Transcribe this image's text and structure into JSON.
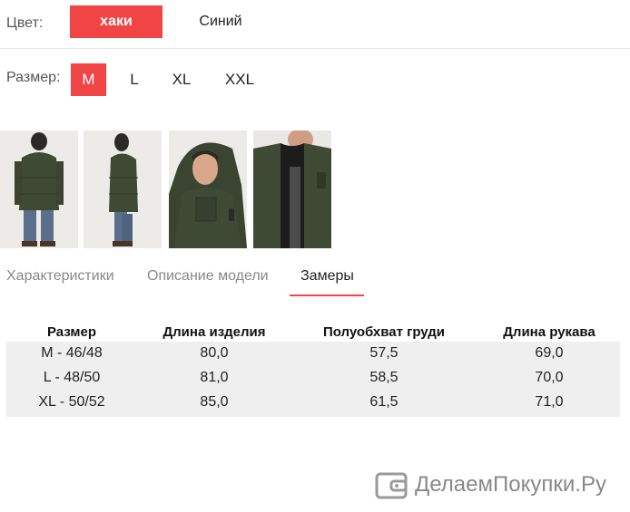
{
  "color": {
    "label": "Цвет:",
    "options": [
      "хаки",
      "Синий"
    ],
    "selected": 0
  },
  "size": {
    "label": "Размер:",
    "options": [
      "M",
      "L",
      "XL",
      "XXL"
    ],
    "selected": 0
  },
  "gallery": {
    "images": [
      "jacket-front-photo",
      "jacket-side-photo",
      "jacket-hood-closeup-photo",
      "jacket-lining-photo"
    ]
  },
  "tabs": {
    "items": [
      "Характеристики",
      "Описание модели",
      "Замеры"
    ],
    "active": 2
  },
  "table": {
    "headers": [
      "Размер",
      "Длина изделия",
      "Полуобхват груди",
      "Длина рукава"
    ],
    "rows": [
      [
        "M - 46/48",
        "80,0",
        "57,5",
        "69,0"
      ],
      [
        "L - 48/50",
        "81,0",
        "58,5",
        "70,0"
      ],
      [
        "XL - 50/52",
        "85,0",
        "61,5",
        "71,0"
      ]
    ]
  },
  "watermark": {
    "text": "ДелаемПокупки.Ру",
    "icon": "wallet-icon"
  },
  "colors": {
    "accent": "#f04445",
    "khaki": "#3f4a35",
    "row_bg": "#efefef"
  }
}
